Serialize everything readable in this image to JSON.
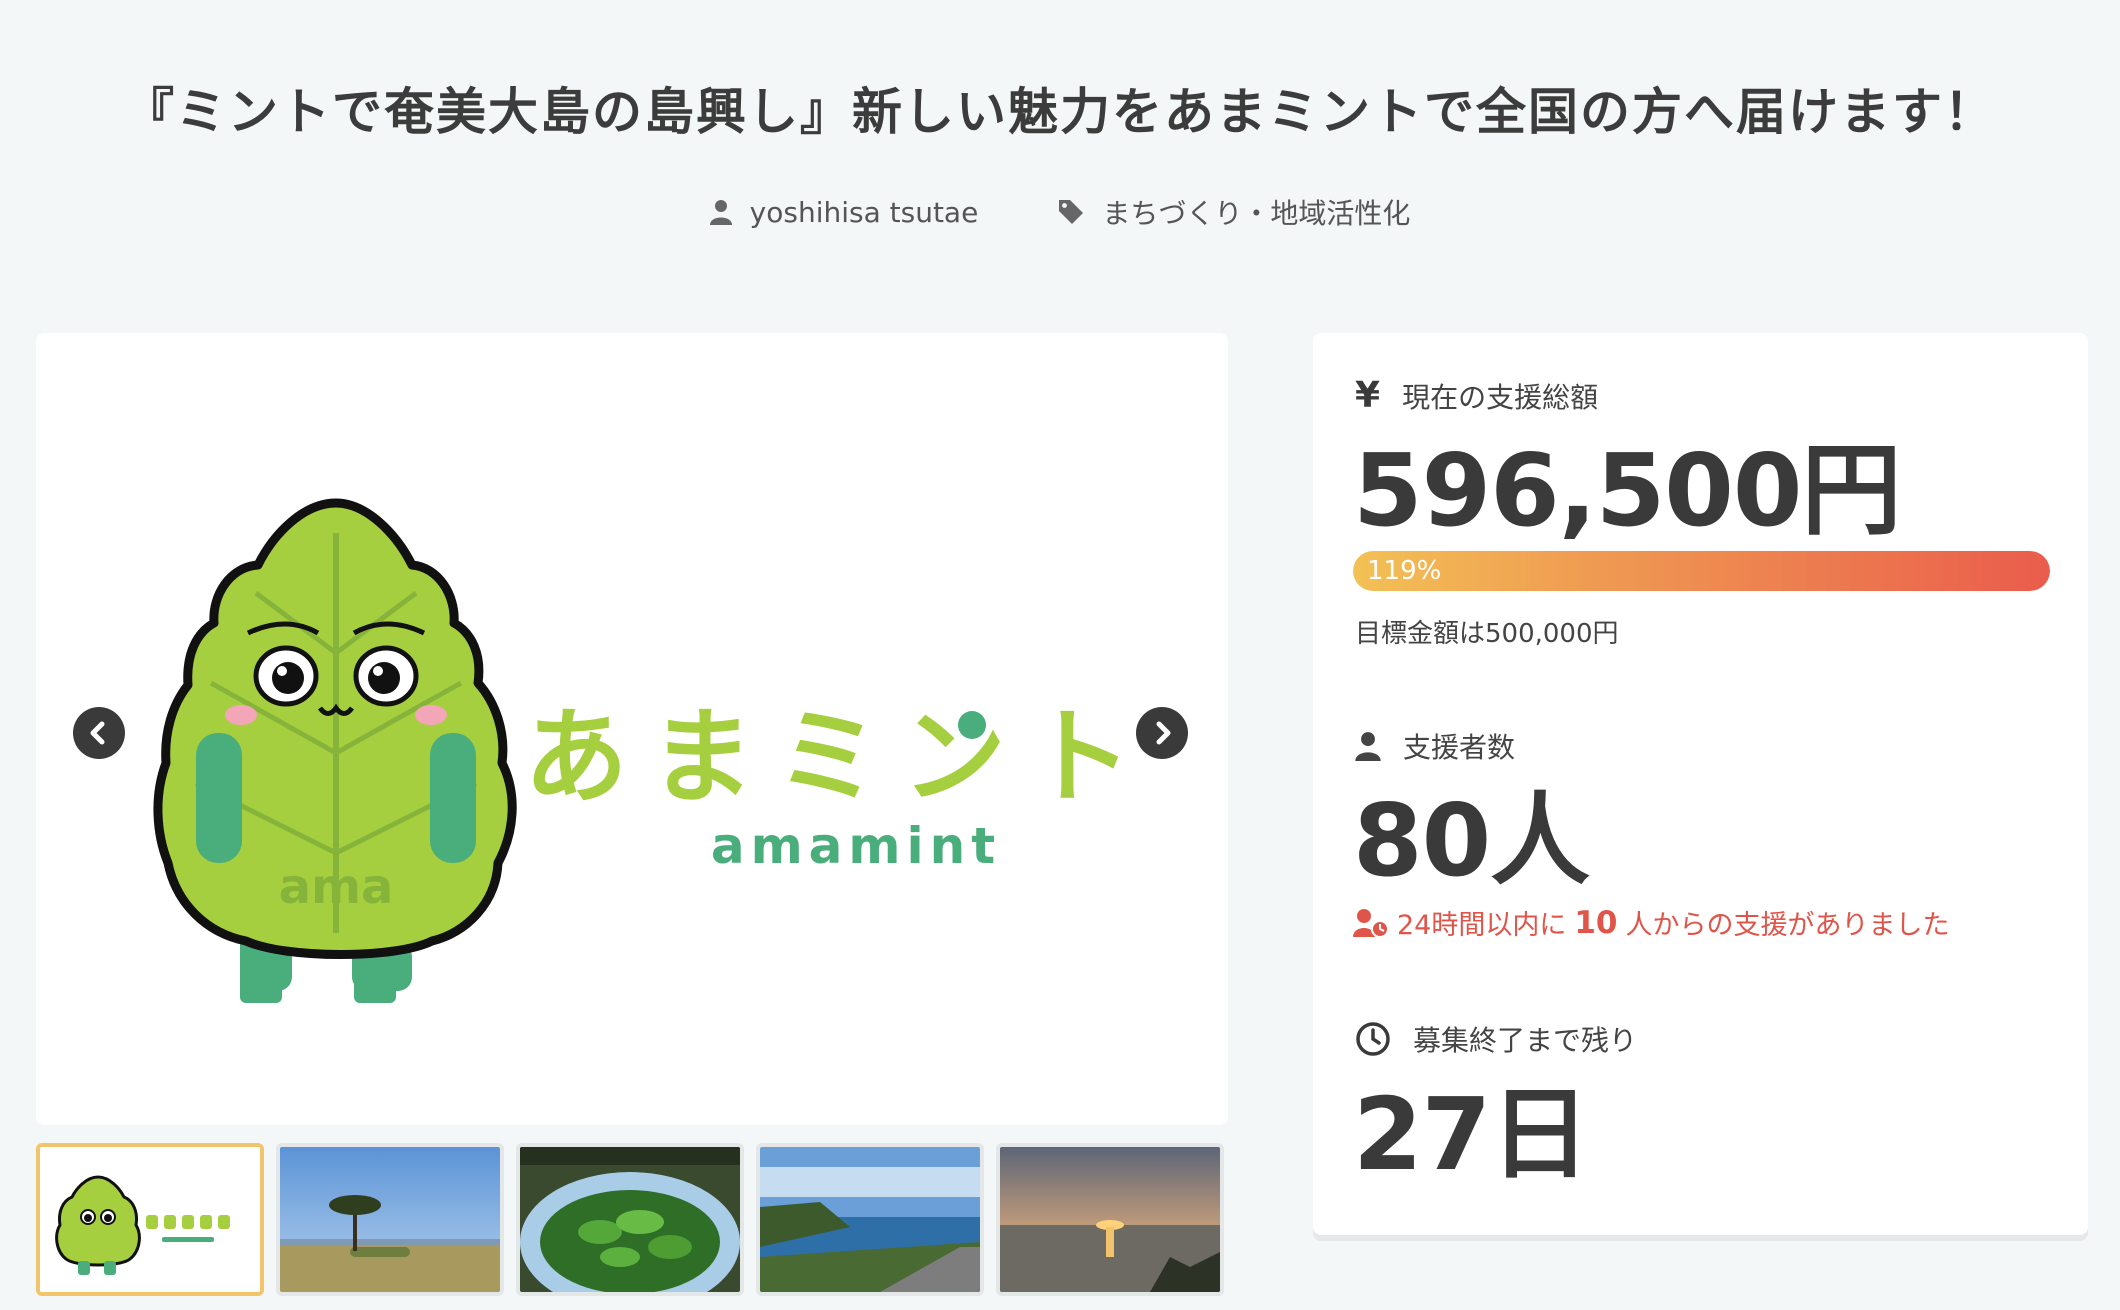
{
  "project": {
    "title": "『ミントで奄美大島の島興し』新しい魅力をあまミントで全国の方へ届けます！",
    "author": "yoshihisa tsutae",
    "category": "まちづくり・地域活性化"
  },
  "gallery": {
    "logo_text_jp": "あまミント",
    "logo_text_en": "amamint",
    "mascot_belly_text": "ama",
    "thumbnails": [
      {
        "name": "thumb-logo",
        "active": true
      },
      {
        "name": "thumb-tree-field",
        "active": false
      },
      {
        "name": "thumb-mint-leaves",
        "active": false
      },
      {
        "name": "thumb-coast-road",
        "active": false
      },
      {
        "name": "thumb-sunset",
        "active": false
      }
    ]
  },
  "stats": {
    "total_label": "現在の支援総額",
    "total_value": "596,500円",
    "progress_text": "119%",
    "progress_fraction": 1.0,
    "target_text": "目標金額は500,000円",
    "supporters_label": "支援者数",
    "supporters_value": "80人",
    "recent_prefix": "24時間以内に",
    "recent_count": "10",
    "recent_suffix": "人からの支援がありました",
    "remaining_label": "募集終了まで残り",
    "remaining_value": "27日"
  },
  "colors": {
    "mint_green": "#a6cf3f",
    "mint_teal": "#4aad7c",
    "alert_red": "#e0554a",
    "thumb_active": "#f2c56b"
  }
}
